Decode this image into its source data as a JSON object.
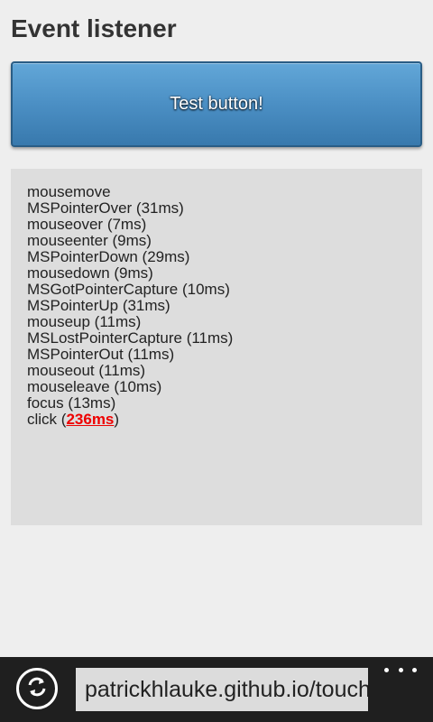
{
  "page": {
    "title": "Event listener",
    "button_label": "Test button!"
  },
  "log": {
    "lines": [
      "mousemove",
      "MSPointerOver (31ms)",
      "mouseover (7ms)",
      "mouseenter (9ms)",
      "MSPointerDown (29ms)",
      "mousedown (9ms)",
      "MSGotPointerCapture (10ms)",
      "MSPointerUp (31ms)",
      "mouseup (11ms)",
      "MSLostPointerCapture (11ms)",
      "MSPointerOut (11ms)",
      "mouseout (11ms)",
      "mouseleave (10ms)",
      "focus (13ms)"
    ],
    "last_event": "click",
    "last_prefix": " (",
    "last_highlight": "236ms",
    "last_suffix": ")"
  },
  "browser": {
    "address": "patrickhlauke.github.io/touch",
    "refresh_icon": "refresh-icon",
    "more_icon": "more-icon",
    "colors": {
      "bar_background": "#1f1f1f",
      "highlight": "#ee0000",
      "button_gradient_top": "#62a7d8",
      "button_gradient_bottom": "#3879ad"
    }
  }
}
